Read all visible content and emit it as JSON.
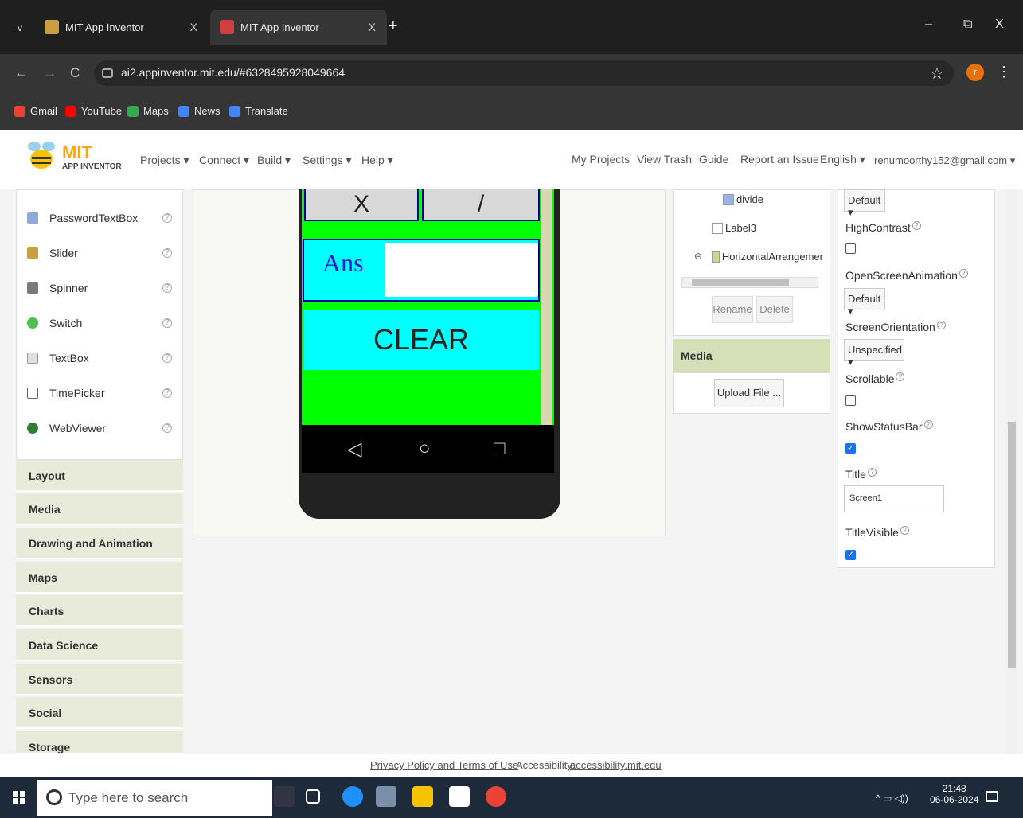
{
  "browser": {
    "tabs": [
      {
        "title": "MIT App Inventor",
        "close": "X"
      },
      {
        "title": "MIT App Inventor",
        "close": "X"
      }
    ],
    "new_tab": "+",
    "tab_menu": "v",
    "window": {
      "minimize": "–",
      "restore": "⧉",
      "close": "X"
    },
    "nav": {
      "back": "←",
      "forward": "→",
      "reload": "C"
    },
    "url": "ai2.appinventor.mit.edu/#6328495928049664",
    "bookmarks": [
      "Gmail",
      "YouTube",
      "Maps",
      "News",
      "Translate"
    ],
    "star": "☆",
    "profile_initial": "r",
    "more": "⋮"
  },
  "app_header": {
    "logo_title": "MIT",
    "logo_subtitle": "APP INVENTOR",
    "menus": [
      "Projects ▾",
      "Connect ▾",
      "Build ▾",
      "Settings ▾",
      "Help ▾"
    ],
    "right_links": [
      "My Projects",
      "View Trash",
      "Guide",
      "Report an Issue",
      "English ▾",
      "renumoorthy152@gmail.com ▾"
    ]
  },
  "palette": {
    "items": [
      {
        "label": "PasswordTextBox",
        "icon": "password-icon",
        "color": "#8fa8d8"
      },
      {
        "label": "Slider",
        "icon": "slider-icon",
        "color": "#c8a040"
      },
      {
        "label": "Spinner",
        "icon": "spinner-icon",
        "color": "#7a7a7a"
      },
      {
        "label": "Switch",
        "icon": "switch-icon",
        "color": "#4cc04c"
      },
      {
        "label": "TextBox",
        "icon": "textbox-icon",
        "color": "#bbbbbb"
      },
      {
        "label": "TimePicker",
        "icon": "timepicker-icon",
        "color": "#999999"
      },
      {
        "label": "WebViewer",
        "icon": "globe-icon",
        "color": "#2e7d32"
      }
    ],
    "help": "?",
    "categories": [
      "Layout",
      "Media",
      "Drawing and Animation",
      "Maps",
      "Charts",
      "Data Science",
      "Sensors",
      "Social",
      "Storage"
    ]
  },
  "viewer": {
    "op_buttons": [
      "X",
      "/"
    ],
    "ans_label": "Ans",
    "clear_label": "CLEAR",
    "nav_icons": [
      "◁",
      "○",
      "□"
    ]
  },
  "components": {
    "items": [
      "divide",
      "Label3",
      "HorizontalArrangemer"
    ],
    "collapse": "⊖",
    "rename": "Rename",
    "delete": "Delete"
  },
  "media": {
    "header": "Media",
    "upload": "Upload File ..."
  },
  "properties": {
    "top_default": "Default ▾",
    "high_contrast": "HighContrast",
    "open_screen_animation": "OpenScreenAnimation",
    "anim_value": "Default ▾",
    "screen_orientation": "ScreenOrientation",
    "orientation_value": "Unspecified ▾",
    "scrollable": "Scrollable",
    "show_status_bar": "ShowStatusBar",
    "title": "Title",
    "title_value": "Screen1",
    "title_visible": "TitleVisible",
    "help": "?",
    "check": "✓"
  },
  "footer": {
    "privacy": "Privacy Policy and Terms of Use",
    "accessibility_prefix": "Accessibility:",
    "accessibility_link": "accessibility.mit.edu"
  },
  "taskbar": {
    "search_placeholder": "Type here to search",
    "time": "21:48",
    "date": "06-06-2024",
    "tray": "^ ▭ ◁))"
  }
}
